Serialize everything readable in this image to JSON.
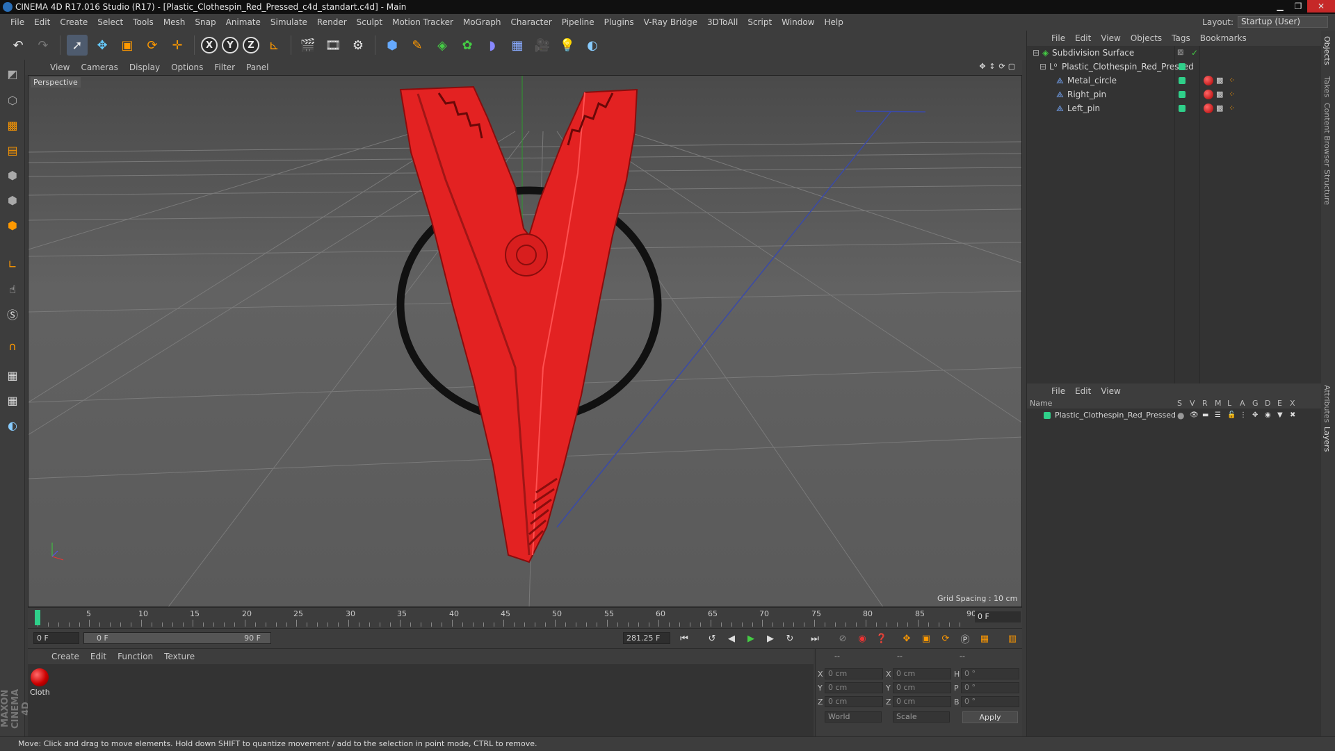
{
  "window": {
    "title": "CINEMA 4D R17.016 Studio (R17) - [Plastic_Clothespin_Red_Pressed_c4d_standart.c4d] - Main"
  },
  "menubar": [
    "File",
    "Edit",
    "Create",
    "Select",
    "Tools",
    "Mesh",
    "Snap",
    "Animate",
    "Simulate",
    "Render",
    "Sculpt",
    "Motion Tracker",
    "MoGraph",
    "Character",
    "Pipeline",
    "Plugins",
    "V-Ray Bridge",
    "3DToAll",
    "Script",
    "Window",
    "Help"
  ],
  "layout": {
    "label": "Layout:",
    "value": "Startup (User)"
  },
  "viewport": {
    "menu": [
      "View",
      "Cameras",
      "Display",
      "Options",
      "Filter",
      "Panel"
    ],
    "label": "Perspective",
    "grid_spacing": "Grid Spacing : 10 cm",
    "accent_color": "#e32222"
  },
  "timeline": {
    "ticks": [
      "0",
      "5",
      "10",
      "15",
      "20",
      "25",
      "30",
      "35",
      "40",
      "45",
      "50",
      "55",
      "60",
      "65",
      "70",
      "75",
      "80",
      "85",
      "90"
    ],
    "current_frame": "0 F"
  },
  "playbar": {
    "start_field": "0 F",
    "range_start": "0 F",
    "range_end": "90 F",
    "fps_field": "281.25 F"
  },
  "material_manager": {
    "menu": [
      "Create",
      "Edit",
      "Function",
      "Texture"
    ],
    "material_name": "Cloth"
  },
  "coordinates": {
    "header": [
      "--",
      "--",
      "--"
    ],
    "rows": [
      {
        "a": "X",
        "av": "0 cm",
        "b": "X",
        "bv": "0 cm",
        "c": "H",
        "cv": "0 °"
      },
      {
        "a": "Y",
        "av": "0 cm",
        "b": "Y",
        "bv": "0 cm",
        "c": "P",
        "cv": "0 °"
      },
      {
        "a": "Z",
        "av": "0 cm",
        "b": "Z",
        "bv": "0 cm",
        "c": "B",
        "cv": "0 °"
      }
    ],
    "space_select": "World",
    "mode_select": "Scale",
    "apply_label": "Apply"
  },
  "object_manager": {
    "menu": [
      "File",
      "Edit",
      "View",
      "Objects",
      "Tags",
      "Bookmarks"
    ],
    "objects": [
      {
        "name": "Subdivision Surface",
        "level": 0
      },
      {
        "name": "Plastic_Clothespin_Red_Pressed",
        "level": 1
      },
      {
        "name": "Metal_circle",
        "level": 2
      },
      {
        "name": "Right_pin",
        "level": 2
      },
      {
        "name": "Left_pin",
        "level": 2
      }
    ]
  },
  "layer_manager": {
    "menu": [
      "File",
      "Edit",
      "View"
    ],
    "columns": [
      "Name",
      "S",
      "V",
      "R",
      "M",
      "L",
      "A",
      "G",
      "D",
      "E",
      "X"
    ],
    "layers": [
      {
        "name": "Plastic_Clothespin_Red_Pressed",
        "color": "#2fd08a"
      }
    ]
  },
  "side_tabs": [
    "Objects",
    "Takes",
    "Content Browser",
    "Structure",
    "Attributes",
    "Layers"
  ],
  "branding": "MAXON CINEMA 4D",
  "status": "Move: Click and drag to move elements. Hold down SHIFT to quantize movement / add to the selection in point mode, CTRL to remove."
}
